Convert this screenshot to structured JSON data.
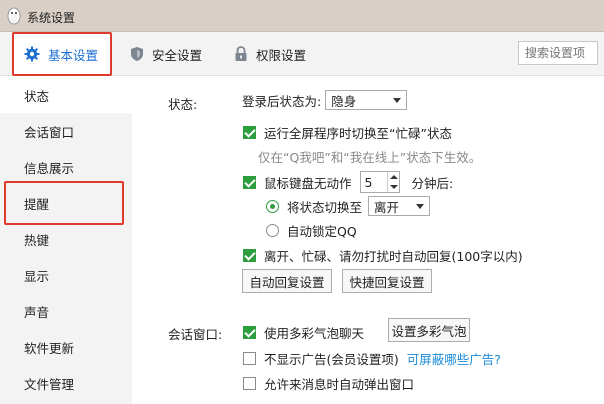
{
  "window": {
    "title": "系统设置"
  },
  "toolbar": {
    "tabs": [
      {
        "label": "基本设置",
        "icon": "gear-icon",
        "active": true
      },
      {
        "label": "安全设置",
        "icon": "shield-icon"
      },
      {
        "label": "权限设置",
        "icon": "lock-icon"
      }
    ],
    "search_placeholder": "搜索设置项"
  },
  "sidebar": {
    "items": [
      {
        "label": "状态",
        "selected": true
      },
      {
        "label": "会话窗口"
      },
      {
        "label": "信息展示"
      },
      {
        "label": "提醒",
        "highlighted": true
      },
      {
        "label": "热键"
      },
      {
        "label": "显示"
      },
      {
        "label": "声音"
      },
      {
        "label": "软件更新"
      },
      {
        "label": "文件管理"
      }
    ]
  },
  "status_section": {
    "label": "状态:",
    "login_status_label": "登录后状态为:",
    "login_status_value": "隐身",
    "fullscreen_busy": {
      "label": "运行全屏程序时切换至“忙碌”状态",
      "checked": true
    },
    "fullscreen_hint": "仅在“Q我吧”和“我在线上”状态下生效。",
    "idle": {
      "label": "鼠标键盘无动作",
      "checked": true,
      "minutes": "5",
      "suffix": "分钟后:"
    },
    "switch_status": {
      "label": "将状态切换至",
      "checked": true,
      "value": "离开"
    },
    "auto_lock": {
      "label": "自动锁定QQ",
      "checked": false
    },
    "auto_reply": {
      "label": "离开、忙碌、请勿打扰时自动回复(100字以内)",
      "checked": true
    },
    "auto_reply_button": "自动回复设置",
    "quick_reply_button": "快捷回复设置"
  },
  "session_section": {
    "label": "会话窗口:",
    "bubble": {
      "label": "使用多彩气泡聊天",
      "checked": true
    },
    "bubble_button": "设置多彩气泡",
    "no_ads": {
      "label": "不显示广告(会员设置项)",
      "checked": false
    },
    "ads_link": "可屏蔽哪些广告?",
    "auto_popup": {
      "label": "允许来消息时自动弹出窗口",
      "checked": false
    }
  },
  "colors": {
    "accent": "#1a6fd1",
    "check_green": "#2e9d3e",
    "highlight_red": "#e03a2f",
    "link": "#1a8bd6"
  }
}
